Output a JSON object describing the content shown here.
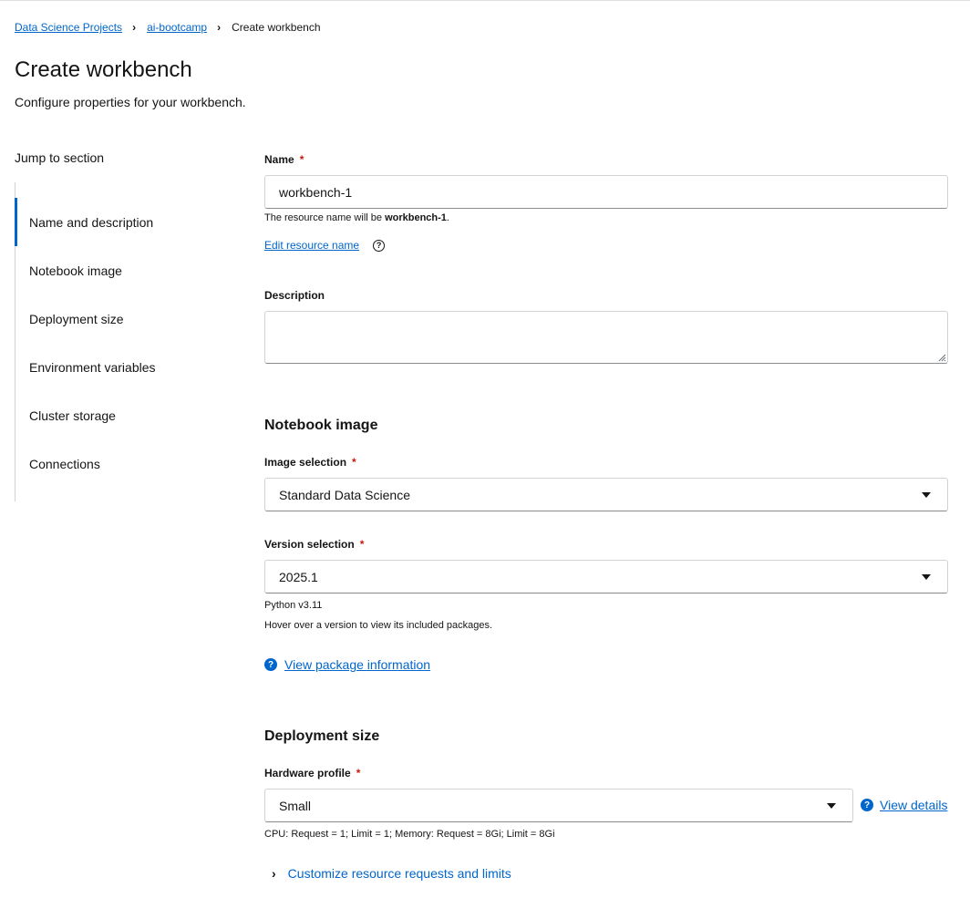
{
  "breadcrumb": {
    "items": [
      "Data Science Projects",
      "ai-bootcamp"
    ],
    "current": "Create workbench"
  },
  "page": {
    "title": "Create workbench",
    "description": "Configure properties for your workbench."
  },
  "jump_nav": {
    "title": "Jump to section",
    "items": [
      "Name and description",
      "Notebook image",
      "Deployment size",
      "Environment variables",
      "Cluster storage",
      "Connections"
    ],
    "active": "Name and description"
  },
  "name_field": {
    "label": "Name",
    "required": "*",
    "value": "workbench-1",
    "helper_prefix": "The resource name will be ",
    "helper_value": "workbench-1",
    "helper_suffix": ".",
    "edit_link": "Edit resource name",
    "help_icon": "?"
  },
  "description_field": {
    "label": "Description",
    "value": ""
  },
  "notebook_image": {
    "title": "Notebook image",
    "image_label": "Image selection",
    "image_value": "Standard Data Science",
    "version_label": "Version selection",
    "version_value": "2025.1",
    "python_version": "Python v3.11",
    "hover_hint": "Hover over a version to view its included packages.",
    "package_link": "View package information",
    "icon": "?"
  },
  "deployment_size": {
    "title": "Deployment size",
    "hardware_label": "Hardware profile",
    "hardware_value": "Small",
    "view_details": "View details",
    "icon": "?",
    "resources": "CPU: Request = 1; Limit = 1; Memory: Request = 8Gi; Limit = 8Gi",
    "customize": "Customize resource requests and limits"
  },
  "required_mark": "*",
  "colors": {
    "link": "#0066cc",
    "required": "#c9190b",
    "border": "#d2d2d2",
    "active": "#0066cc"
  }
}
